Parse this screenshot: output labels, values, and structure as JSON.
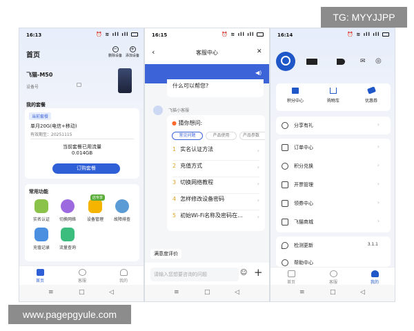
{
  "watermarks": {
    "top": "TG: MYYJJPP",
    "bottom": "www.pagepgyule.com"
  },
  "phone1": {
    "time": "16:13",
    "title": "首页",
    "actions": [
      {
        "label": "删除设备"
      },
      {
        "label": "添加设备"
      }
    ],
    "device_name": "飞猫-M50",
    "device_sub": "设备号",
    "plan_section": "我的套餐",
    "plan_tag": "当前套餐",
    "plan_name": "单月20G(电信+移动)",
    "plan_expiry": "有效期至：20251115",
    "usage_label": "当前套餐已用流量",
    "usage_value": "0.014GB",
    "order_button": "订购套餐",
    "func_section": "常用功能",
    "func_badge": "店专享",
    "functions": [
      {
        "label": "实名认证",
        "color": "#8bc34a"
      },
      {
        "label": "切换网络",
        "color": "#9c6ade"
      },
      {
        "label": "设备管理",
        "color": "#f4b400"
      },
      {
        "label": "故障排查",
        "color": "#5b9bd5"
      },
      {
        "label": "充值记录",
        "color": "#4a8fe0"
      },
      {
        "label": "流量查询",
        "color": "#3dbd7d"
      }
    ],
    "tabs": [
      {
        "label": "首页"
      },
      {
        "label": "客服"
      },
      {
        "label": "我的"
      }
    ]
  },
  "phone2": {
    "time": "16:15",
    "title": "客服中心",
    "prev_msg": "什么可以帮您?",
    "bot_name": "飞猫小客服",
    "guess_title": "猜你想问:",
    "chips": [
      "常见问题",
      "产品使用",
      "产品参数"
    ],
    "questions": [
      {
        "num": "1",
        "text": "实名认证方法"
      },
      {
        "num": "2",
        "text": "充值方式"
      },
      {
        "num": "3",
        "text": "切换网络教程"
      },
      {
        "num": "4",
        "text": "怎样修改设备密码"
      },
      {
        "num": "5",
        "text": "初始Wi-Fi名称及密码在..."
      }
    ],
    "satisfaction": "满意度评价",
    "input_placeholder": "请输入您想要咨询的问题"
  },
  "phone3": {
    "time": "16:14",
    "quick": [
      {
        "label": "积分中心"
      },
      {
        "label": "购物车"
      },
      {
        "label": "优惠券"
      }
    ],
    "share": "分享有礼",
    "menu": [
      {
        "label": "订单中心"
      },
      {
        "label": "积分兑换"
      },
      {
        "label": "开票管理"
      },
      {
        "label": "领券中心"
      },
      {
        "label": "飞猫商城"
      }
    ],
    "update_label": "检测更新",
    "version": "3.1.1",
    "help": "帮助中心",
    "tabs": [
      {
        "label": "首页"
      },
      {
        "label": "客服"
      },
      {
        "label": "我的"
      }
    ],
    "accent": "#1f57c8"
  }
}
